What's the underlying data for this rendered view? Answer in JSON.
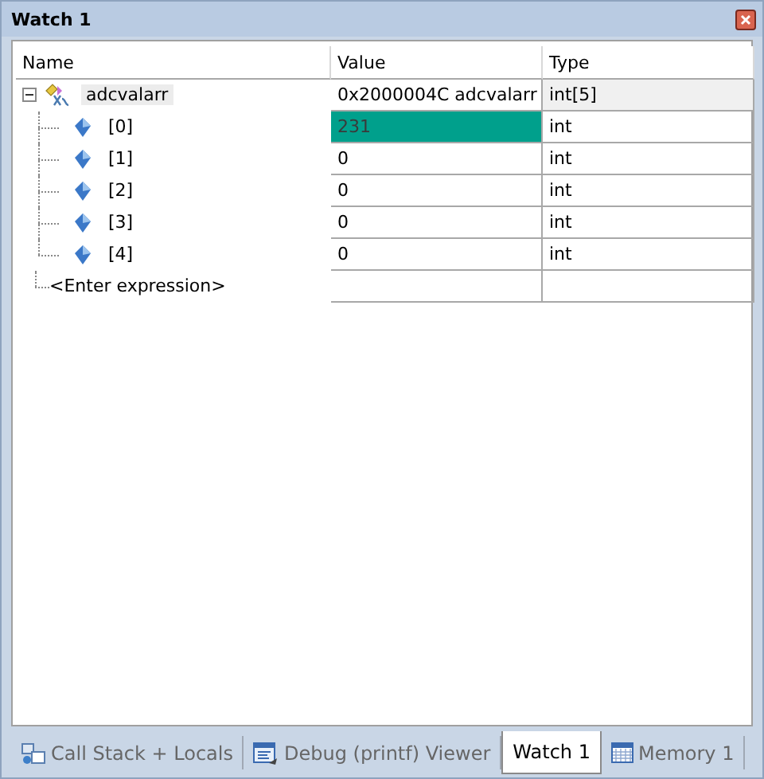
{
  "window": {
    "title": "Watch 1"
  },
  "table": {
    "columns": [
      "Name",
      "Value",
      "Type"
    ],
    "rows": [
      {
        "name": "adcvalarr",
        "value": "0x2000004C adcvalarr",
        "type": "int[5]",
        "selected": true,
        "expanded": true,
        "changed": false,
        "children": [
          {
            "name": "[0]",
            "value": "231",
            "type": "int",
            "selected": false,
            "changed": true
          },
          {
            "name": "[1]",
            "value": "0",
            "type": "int",
            "selected": false,
            "changed": false
          },
          {
            "name": "[2]",
            "value": "0",
            "type": "int",
            "selected": false,
            "changed": false
          },
          {
            "name": "[3]",
            "value": "0",
            "type": "int",
            "selected": false,
            "changed": false
          },
          {
            "name": "[4]",
            "value": "0",
            "type": "int",
            "selected": false,
            "changed": false
          }
        ]
      }
    ],
    "entry": {
      "placeholder": "<Enter expression>"
    }
  },
  "tabs": [
    {
      "label": "Call Stack + Locals",
      "selected": false,
      "kind": "stack"
    },
    {
      "label": "Debug (printf) Viewer",
      "selected": false,
      "kind": "viewer"
    },
    {
      "label": "Watch 1",
      "selected": true,
      "kind": "none"
    },
    {
      "label": "Memory 1",
      "selected": false,
      "kind": "memory"
    }
  ]
}
